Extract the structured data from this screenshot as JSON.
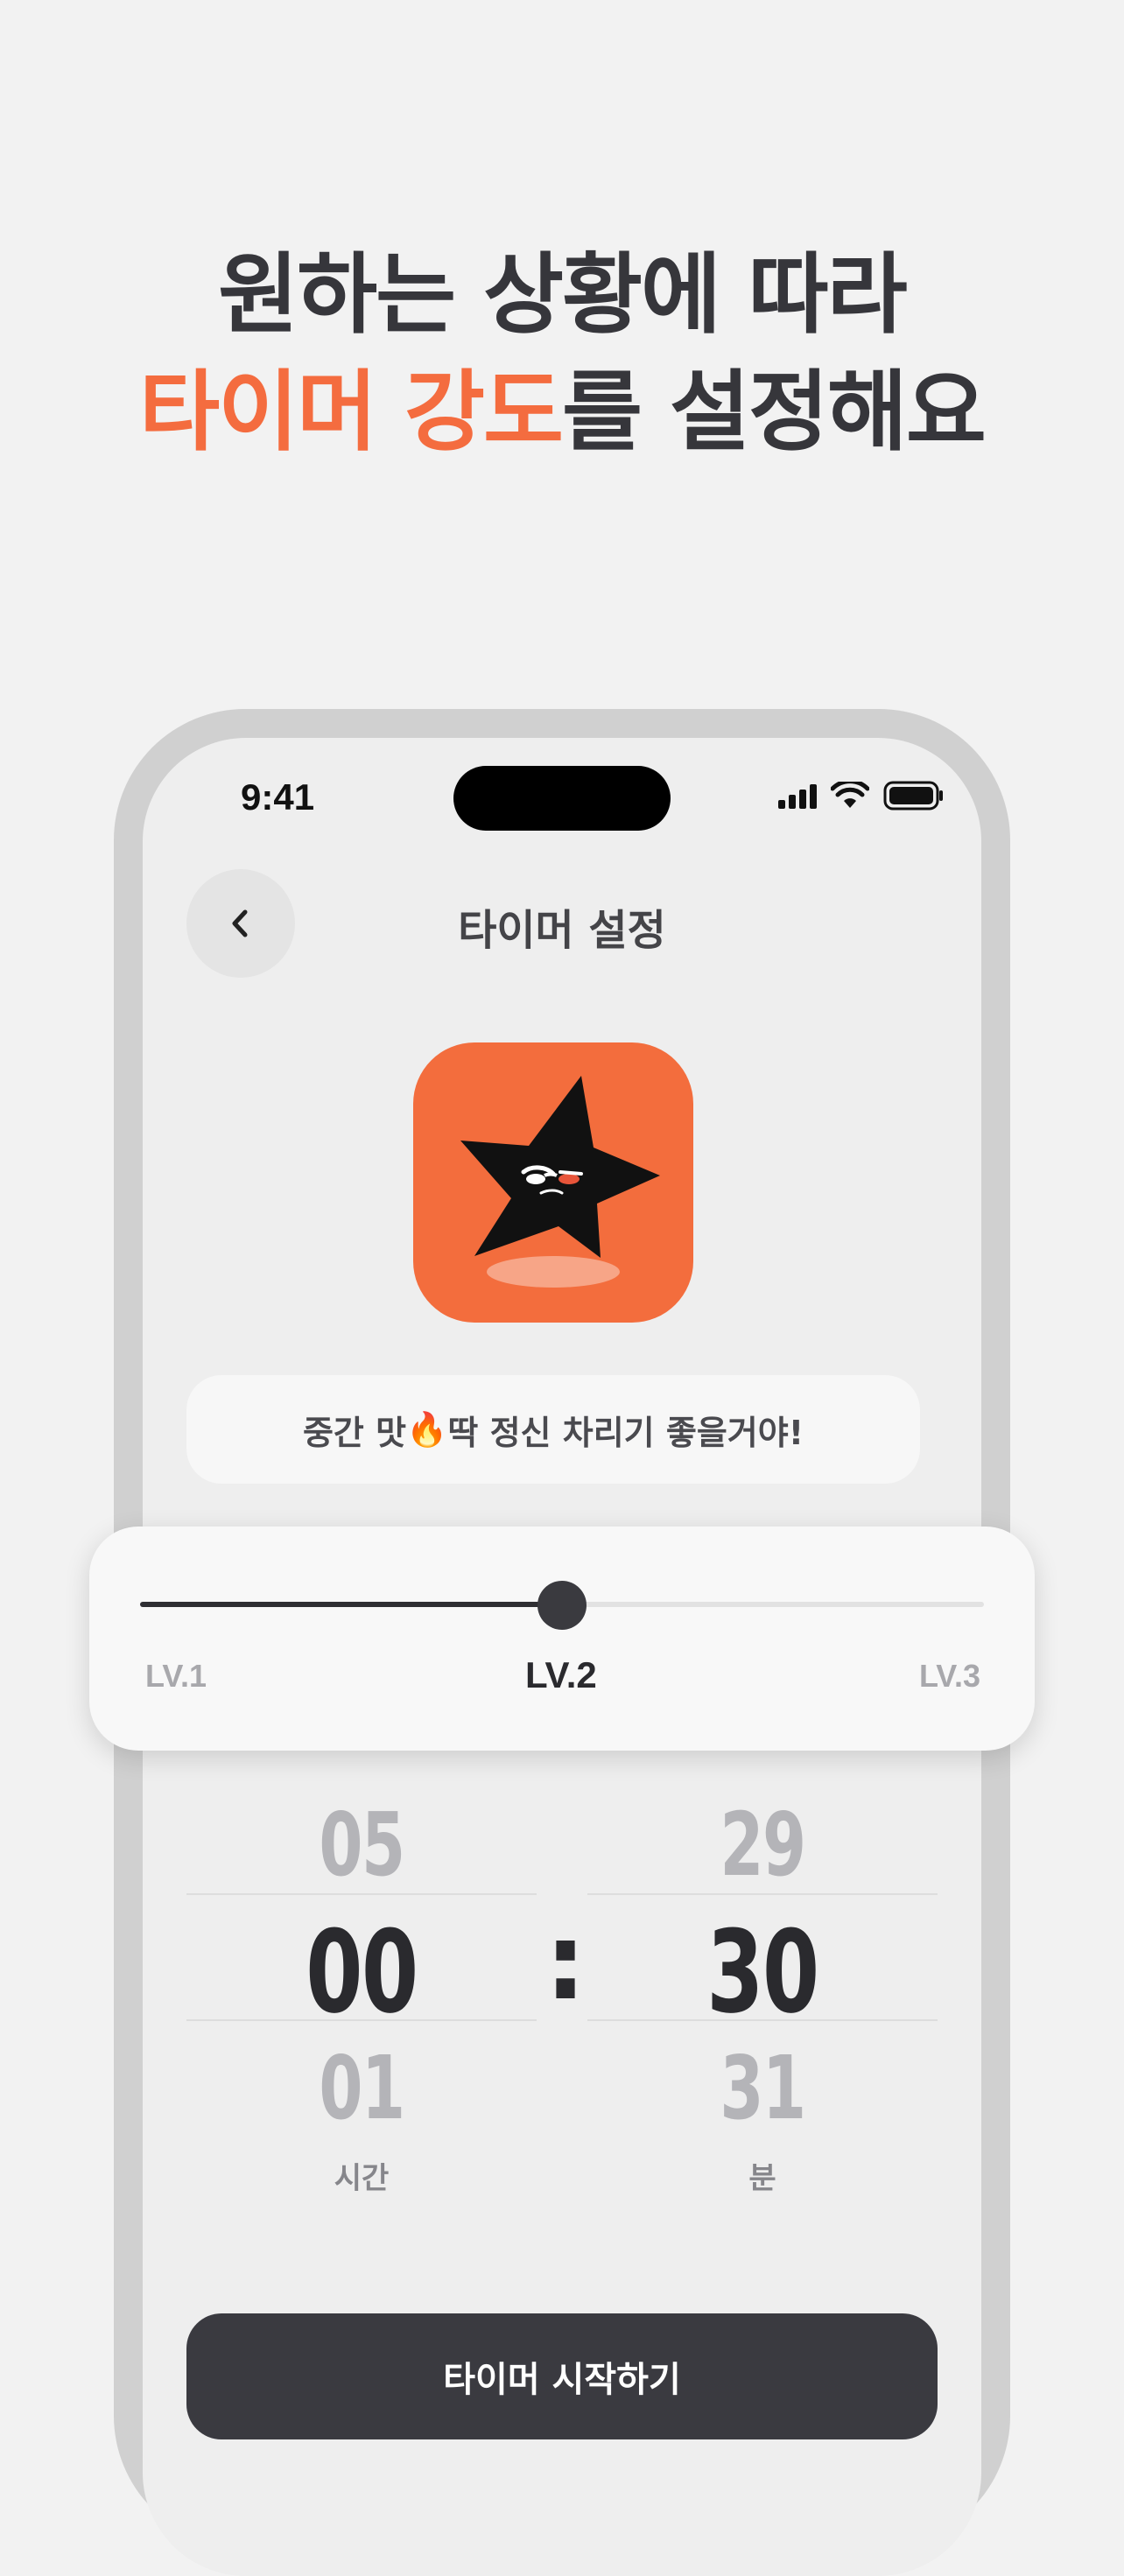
{
  "headline": {
    "line1": "원하는 상황에 따라",
    "line2_accent": "타이머 강도",
    "line2_rest": "를 설정해요"
  },
  "status_bar": {
    "time": "9:41"
  },
  "nav": {
    "back_icon": "chevron-left-icon",
    "title": "타이머 설정"
  },
  "mascot": {
    "icon": "angry-star-icon"
  },
  "message": {
    "text_before": "중간 맛",
    "emoji": "🔥",
    "text_after": " 딱 정신 차리기 좋을거야!"
  },
  "intensity": {
    "levels": [
      "LV.1",
      "LV.2",
      "LV.3"
    ],
    "selected": "LV.2",
    "position_fraction": 0.5
  },
  "time_picker": {
    "hours": {
      "prev": "05",
      "selected": "00",
      "next": "01",
      "unit": "시간"
    },
    "separator": ":",
    "minutes": {
      "prev": "29",
      "selected": "30",
      "next": "31",
      "unit": "분"
    }
  },
  "start_button": {
    "label": "타이머 시작하기"
  },
  "colors": {
    "accent": "#f46c3f",
    "dark": "#3a3a40",
    "background": "#f2f2f2"
  }
}
